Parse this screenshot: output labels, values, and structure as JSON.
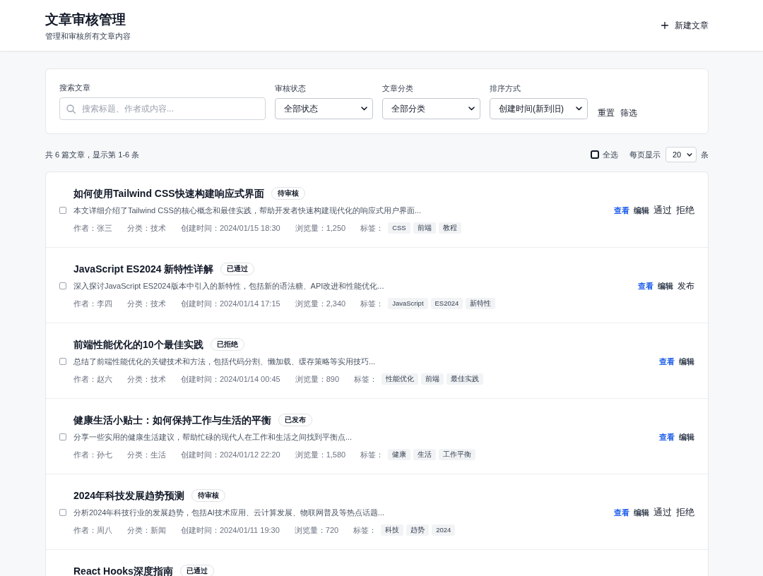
{
  "header": {
    "title": "文章审核管理",
    "subtitle": "管理和审核所有文章内容",
    "new_button": "新建文章"
  },
  "filters": {
    "search": {
      "label": "搜索文章",
      "placeholder": "搜索标题、作者或内容..."
    },
    "selects": [
      {
        "label": "审核状态",
        "value": "全部状态"
      },
      {
        "label": "文章分类",
        "value": "全部分类"
      },
      {
        "label": "排序方式",
        "value": "创建时间(新到旧)"
      }
    ],
    "buttons": [
      "重置",
      "筛选"
    ]
  },
  "list_header": {
    "summary": "共 6 篇文章，显示第 1-6 条",
    "select_all": {
      "label": "全选",
      "checked": false
    },
    "page_size": {
      "label": "每页显示",
      "value": "20",
      "unit": "条"
    }
  },
  "articles": [
    {
      "checked": false,
      "title": "如何使用Tailwind CSS快速构建响应式界面",
      "status": "待审核",
      "excerpt": "本文详细介绍了Tailwind CSS的核心概念和最佳实践，帮助开发者快速构建现代化的响应式用户界面...",
      "meta": [
        "作者：张三",
        "分类：技术",
        "创建时间：2024/01/15 18:30",
        "浏览量：1,250"
      ],
      "tags_label": "标签：",
      "tags": [
        "CSS",
        "前端",
        "教程"
      ],
      "actions": [
        {
          "kind": "view",
          "label": "查看"
        },
        {
          "kind": "edit",
          "label": "编辑"
        },
        {
          "kind": "approve",
          "label": "通过"
        },
        {
          "kind": "reject",
          "label": "拒绝"
        }
      ]
    },
    {
      "checked": false,
      "title": "JavaScript ES2024 新特性详解",
      "status": "已通过",
      "excerpt": "深入探讨JavaScript ES2024版本中引入的新特性，包括新的语法糖、API改进和性能优化...",
      "meta": [
        "作者：李四",
        "分类：技术",
        "创建时间：2024/01/14 17:15",
        "浏览量：2,340"
      ],
      "tags_label": "标签：",
      "tags": [
        "JavaScript",
        "ES2024",
        "新特性"
      ],
      "actions": [
        {
          "kind": "view",
          "label": "查看"
        },
        {
          "kind": "edit",
          "label": "编辑"
        },
        {
          "kind": "publish",
          "label": "发布"
        }
      ]
    },
    {
      "checked": false,
      "title": "前端性能优化的10个最佳实践",
      "status": "已拒绝",
      "excerpt": "总结了前端性能优化的关键技术和方法，包括代码分割、懒加载、缓存策略等实用技巧...",
      "meta": [
        "作者：赵六",
        "分类：技术",
        "创建时间：2024/01/14 00:45",
        "浏览量：890"
      ],
      "tags_label": "标签：",
      "tags": [
        "性能优化",
        "前端",
        "最佳实践"
      ],
      "actions": [
        {
          "kind": "view",
          "label": "查看"
        },
        {
          "kind": "edit",
          "label": "编辑"
        }
      ]
    },
    {
      "checked": false,
      "title": "健康生活小贴士：如何保持工作与生活的平衡",
      "status": "已发布",
      "excerpt": "分享一些实用的健康生活建议，帮助忙碌的现代人在工作和生活之间找到平衡点...",
      "meta": [
        "作者：孙七",
        "分类：生活",
        "创建时间：2024/01/12 22:20",
        "浏览量：1,580"
      ],
      "tags_label": "标签：",
      "tags": [
        "健康",
        "生活",
        "工作平衡"
      ],
      "actions": [
        {
          "kind": "view",
          "label": "查看"
        },
        {
          "kind": "edit",
          "label": "编辑"
        }
      ]
    },
    {
      "checked": false,
      "title": "2024年科技发展趋势预测",
      "status": "待审核",
      "excerpt": "分析2024年科技行业的发展趋势，包括AI技术应用、云计算发展、物联网普及等热点话题...",
      "meta": [
        "作者：周八",
        "分类：新闻",
        "创建时间：2024/01/11 19:30",
        "浏览量：720"
      ],
      "tags_label": "标签：",
      "tags": [
        "科技",
        "趋势",
        "2024"
      ],
      "actions": [
        {
          "kind": "view",
          "label": "查看"
        },
        {
          "kind": "edit",
          "label": "编辑"
        },
        {
          "kind": "approve",
          "label": "通过"
        },
        {
          "kind": "reject",
          "label": "拒绝"
        }
      ]
    },
    {
      "title": "React Hooks深度指南",
      "status": "已通过"
    }
  ]
}
